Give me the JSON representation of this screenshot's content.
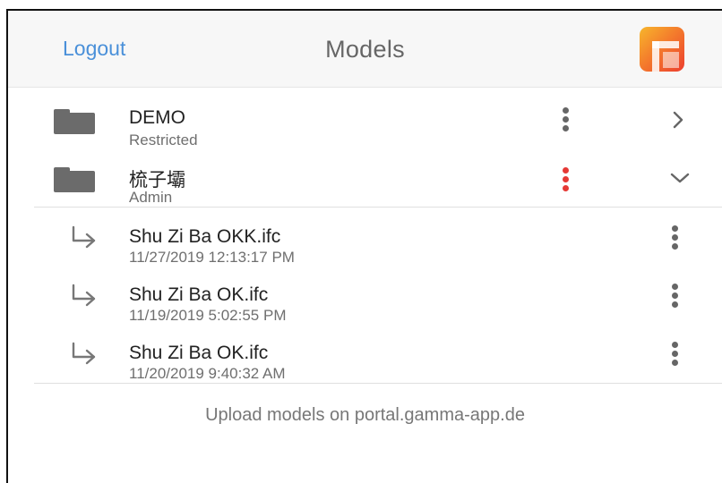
{
  "header": {
    "logout_label": "Logout",
    "title": "Models",
    "logo_icon": "gamma-app-logo-icon"
  },
  "projects": [
    {
      "name": "DEMO",
      "role": "Restricted",
      "menu_color": "#666666",
      "expanded": false,
      "chevron_icon": "chevron-right-icon"
    },
    {
      "name": "梳子壩",
      "role": "Admin",
      "menu_color": "#e53935",
      "expanded": true,
      "chevron_icon": "chevron-down-icon"
    }
  ],
  "models": [
    {
      "name": "Shu Zi Ba  OKK.ifc",
      "date": "11/27/2019 12:13:17 PM"
    },
    {
      "name": "Shu Zi Ba OK.ifc",
      "date": "11/19/2019 5:02:55 PM"
    },
    {
      "name": "Shu Zi Ba OK.ifc",
      "date": "11/20/2019 9:40:32 AM"
    }
  ],
  "footer": {
    "note": "Upload models on portal.gamma-app.de"
  },
  "colors": {
    "accent": "#4a90d9",
    "alert": "#e53935",
    "icon_gray": "#6b6b6b"
  }
}
